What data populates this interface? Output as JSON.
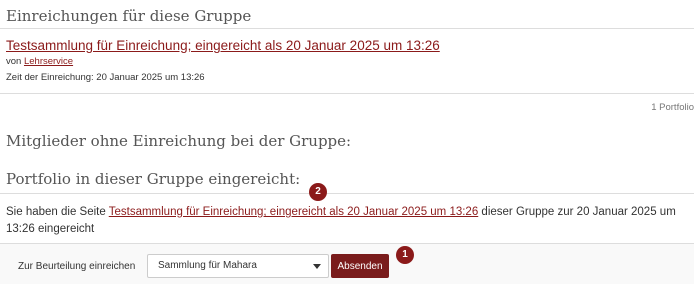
{
  "submissions": {
    "heading": "Einreichungen für diese Gruppe",
    "item": {
      "title": "Testsammlung für Einreichung; eingereicht als 20 Januar 2025 um 13:26",
      "by_prefix": "von ",
      "by_user": "Lehrservice",
      "time": "Zeit der Einreichung: 20 Januar 2025 um 13:26"
    },
    "count": "1 Portfolio"
  },
  "members": {
    "heading": "Mitglieder ohne Einreichung bei der Gruppe:"
  },
  "portfolio": {
    "heading": "Portfolio in dieser Gruppe eingereicht:",
    "text_before": "Sie haben die Seite ",
    "link": "Testsammlung für Einreichung; eingereicht als 20 Januar 2025 um 13:26",
    "text_after": " dieser Gruppe zur 20 Januar 2025 um 13:26 eingereicht"
  },
  "assess": {
    "label": "Zur Beurteilung einreichen",
    "selected": "Sammlung für Mahara",
    "submit_label": "Absenden"
  },
  "badges": {
    "one": "1",
    "two": "2"
  },
  "colors": {
    "accent": "#8b1a1a",
    "button": "#7a1c1c"
  }
}
